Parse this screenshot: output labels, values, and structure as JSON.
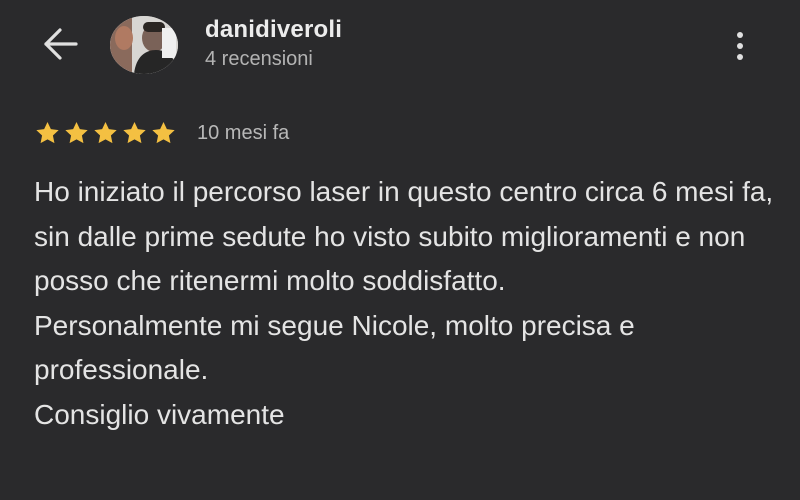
{
  "header": {
    "back_icon": "arrow-left-icon",
    "username": "danidiveroli",
    "review_count": "4 recensioni",
    "menu_icon": "more-vertical-icon"
  },
  "review": {
    "rating": 5,
    "max_rating": 5,
    "star_color": "#f4c042",
    "time_ago": "10 mesi fa",
    "paragraphs": [
      "Ho iniziato il percorso laser in questo centro circa 6 mesi fa, sin dalle prime sedute ho visto subito miglioramenti e non posso che ritenermi molto soddisfatto.",
      "Personalmente mi segue Nicole, molto precisa e professionale.",
      "Consiglio vivamente"
    ]
  },
  "colors": {
    "background": "#2a2a2c",
    "text_primary": "#e4e4e4",
    "text_secondary": "#b3b3b3"
  }
}
